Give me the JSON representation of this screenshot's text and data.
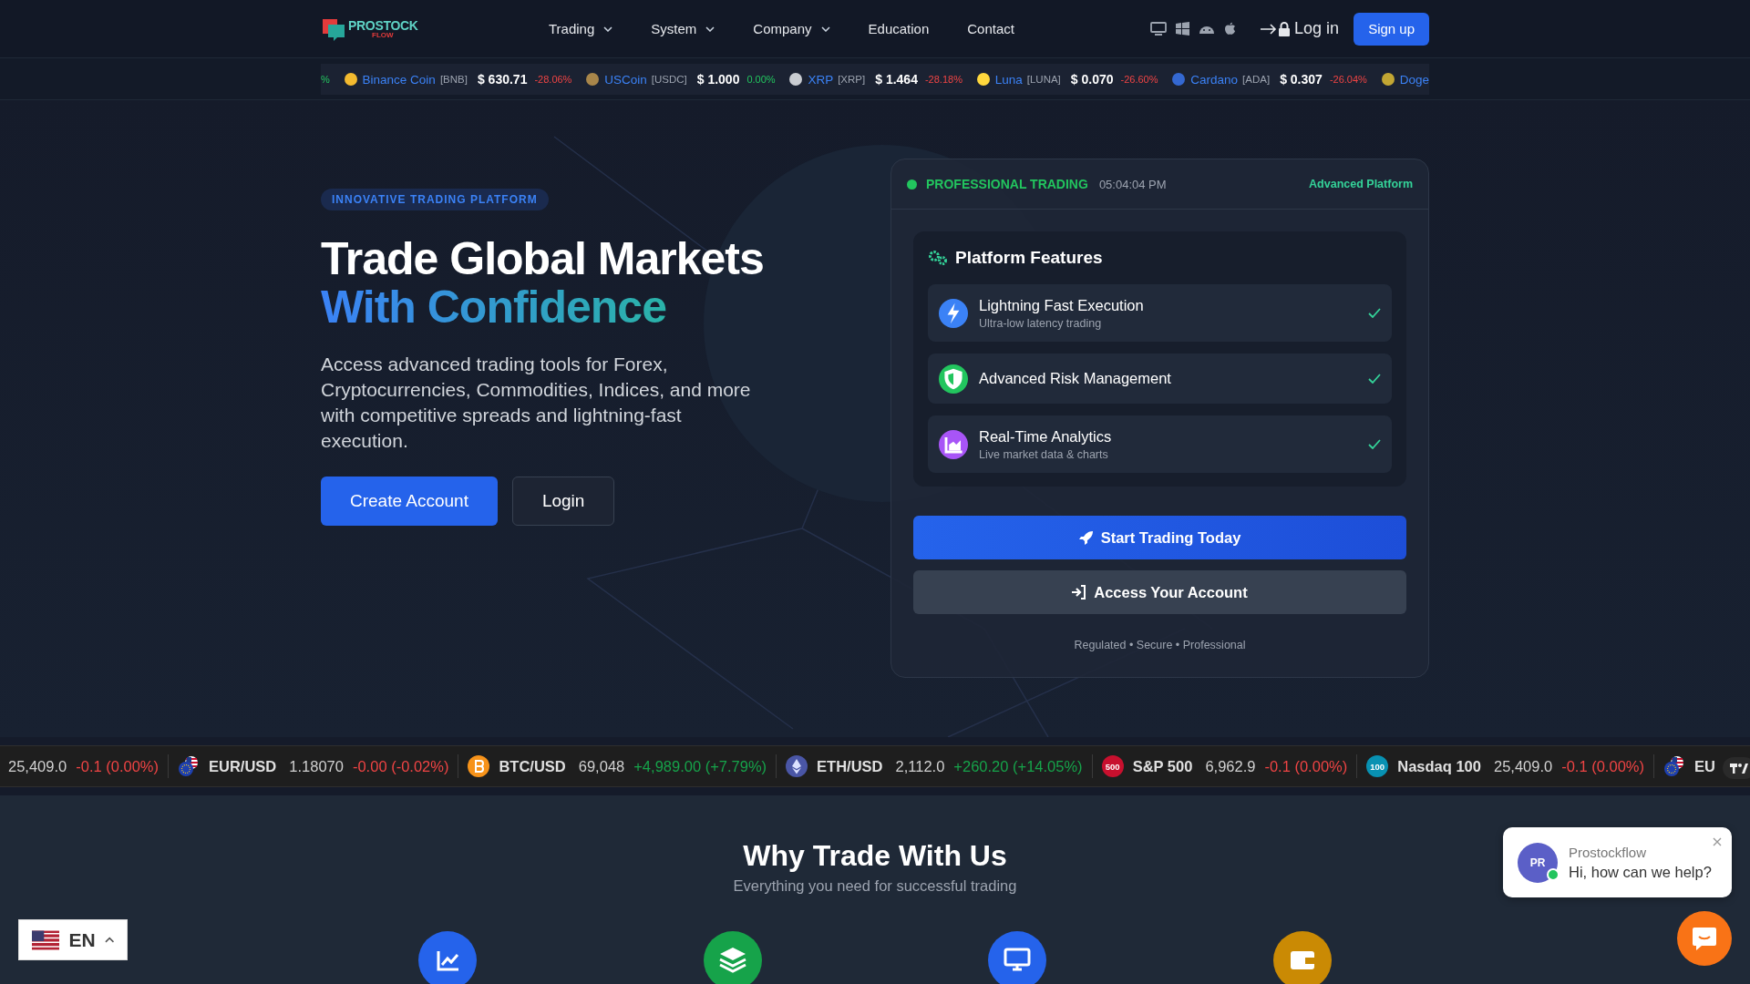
{
  "nav": {
    "logo": {
      "name": "PROSTOCK",
      "tagline": "FLOW"
    },
    "menu": [
      {
        "label": "Trading",
        "dropdown": true
      },
      {
        "label": "System",
        "dropdown": true
      },
      {
        "label": "Company",
        "dropdown": true
      },
      {
        "label": "Education",
        "dropdown": false
      },
      {
        "label": "Contact",
        "dropdown": false
      }
    ],
    "login": "Log in",
    "signup": "Sign up"
  },
  "crypto_ticker": [
    {
      "kind": "tail",
      "change": "%",
      "positive": true
    },
    {
      "kind": "coin",
      "name": "Binance Coin",
      "symbol": "[BNB]",
      "price": "$ 630.71",
      "change": "-28.06%",
      "positive": false,
      "color": "#f3ba2f"
    },
    {
      "kind": "coin",
      "name": "USCoin",
      "symbol": "[USDC]",
      "price": "$ 1.000",
      "change": "0.00%",
      "positive": true,
      "color": "#a8864a"
    },
    {
      "kind": "coin",
      "name": "XRP",
      "symbol": "[XRP]",
      "price": "$ 1.464",
      "change": "-28.18%",
      "positive": false,
      "color": "#c9ccd1"
    },
    {
      "kind": "coin",
      "name": "Luna",
      "symbol": "[LUNA]",
      "price": "$ 0.070",
      "change": "-26.60%",
      "positive": false,
      "color": "#ffd83d"
    },
    {
      "kind": "coin",
      "name": "Cardano",
      "symbol": "[ADA]",
      "price": "$ 0.307",
      "change": "-26.04%",
      "positive": false,
      "color": "#3468d1"
    },
    {
      "kind": "head",
      "name": "Doge",
      "color": "#c2a633"
    }
  ],
  "hero": {
    "badge": "INNOVATIVE TRADING PLATFORM",
    "title_line1": "Trade Global Markets",
    "title_line2": "With Confidence",
    "description": "Access advanced trading tools for Forex, Cryptocurrencies, Commodities, Indices, and more with competitive spreads and lightning-fast execution.",
    "buttons": [
      {
        "label": "Create Account",
        "kind": "primary"
      },
      {
        "label": "Login",
        "kind": "secondary"
      }
    ]
  },
  "platform_card": {
    "status": "PROFESSIONAL TRADING",
    "time": "05:04:04 PM",
    "platform_label": "Advanced Platform",
    "features_title": "Platform Features",
    "features": [
      {
        "title": "Lightning Fast Execution",
        "subtitle": "Ultra-low latency trading",
        "kind": "bolt",
        "color": "#3b82f6",
        "checked": true
      },
      {
        "title": "Advanced Risk Management",
        "kind": "shield",
        "color": "#22c55e",
        "checked": true
      },
      {
        "title": "Real-Time Analytics",
        "subtitle": "Live market data & charts",
        "kind": "chart",
        "color": "#a855f7",
        "checked": true
      }
    ],
    "actions": [
      {
        "label": "Start Trading Today",
        "kind": "primary"
      },
      {
        "label": "Access Your Account",
        "kind": "secondary"
      }
    ],
    "footer": "Regulated • Secure • Professional"
  },
  "market_ticker": [
    {
      "kind": "plain",
      "price": "25,409.0",
      "change": "-0.1 (0.00%)",
      "positive": false
    },
    {
      "kind": "flags",
      "symbol": "EUR/USD",
      "price": "1.18070",
      "change": "-0.00 (-0.02%)",
      "positive": false
    },
    {
      "kind": "bitcoin",
      "color": "#f7931a",
      "symbol": "BTC/USD",
      "price": "69,048",
      "change": "+4,989.00 (+7.79%)",
      "positive": true
    },
    {
      "kind": "ether",
      "color": "#4a56a6",
      "symbol": "ETH/USD",
      "price": "2,112.0",
      "change": "+260.20 (+14.05%)",
      "positive": true
    },
    {
      "kind": "badge",
      "badge": "500",
      "color": "#c8102e",
      "symbol": "S&P 500",
      "price": "6,962.9",
      "change": "-0.1 (0.00%)",
      "positive": false
    },
    {
      "kind": "badge",
      "badge": "100",
      "color": "#0891b2",
      "symbol": "Nasdaq 100",
      "price": "25,409.0",
      "change": "-0.1 (0.00%)",
      "positive": false
    },
    {
      "kind": "flags",
      "symbol": "EU"
    }
  ],
  "why": {
    "title": "Why Trade With Us",
    "subtitle": "Everything you need for successful trading",
    "icons": [
      {
        "kind": "chart",
        "color": "#2563eb"
      },
      {
        "kind": "layers",
        "color": "#16a34a"
      },
      {
        "kind": "monitor",
        "color": "#2563eb"
      },
      {
        "kind": "wallet",
        "color": "#ca8a04"
      }
    ]
  },
  "language": {
    "code": "EN"
  },
  "chat": {
    "avatar": "PR",
    "name": "Prostockflow",
    "message": "Hi, how can we help?",
    "online": true
  }
}
